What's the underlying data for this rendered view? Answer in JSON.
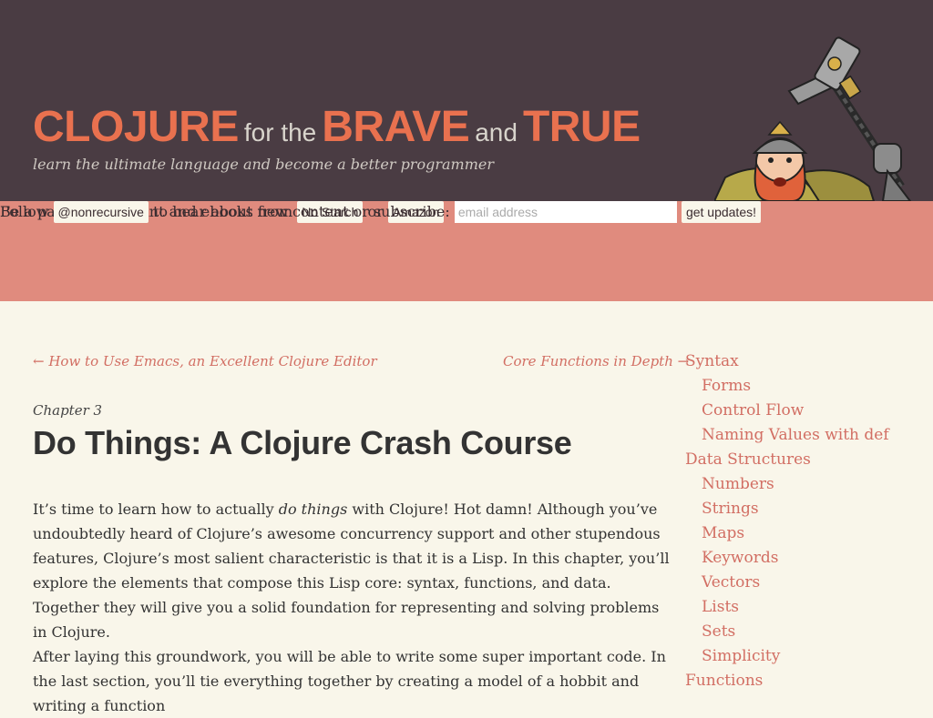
{
  "header": {
    "logo": {
      "w1": "CLOJURE",
      "w2": "for the",
      "w3": "BRAVE",
      "w4": "and",
      "w5": "TRUE"
    },
    "tagline": "learn the ultimate language and become a better programmer"
  },
  "promo": {
    "line1_text": "Be a pal and buy print and ebooks from",
    "no_starch": "No Starch",
    "or": "or",
    "amazon": "Amazon",
    "follow": "Follow",
    "twitter": "@nonrecursive",
    "subscribe_text": "to hear about new content or subscribe:",
    "email_placeholder": "email address",
    "submit": "get updates!"
  },
  "nav": {
    "prev": "← How to Use Emacs, an Excellent Clojure Editor",
    "next": "Core Functions in Depth →"
  },
  "article": {
    "chapter": "Chapter 3",
    "title": "Do Things: A Clojure Crash Course",
    "p1_a": "It’s time to learn how to actually ",
    "p1_em": "do things",
    "p1_b": " with Clojure! Hot damn! Although you’ve undoubtedly heard of Clojure’s awesome concurrency support and other stupendous features, Clojure’s most salient characteristic is that it is a Lisp. In this chapter, you’ll explore the elements that compose this Lisp core: syntax, functions, and data. Together they will give you a solid foundation for representing and solving problems in Clojure.",
    "p2": "After laying this groundwork, you will be able to write some super important code. In the last section, you’ll tie everything together by creating a model of a hobbit and writing a function"
  },
  "toc": [
    {
      "label": "Syntax",
      "level": 0
    },
    {
      "label": "Forms",
      "level": 1
    },
    {
      "label": "Control Flow",
      "level": 1
    },
    {
      "label": "Naming Values with def",
      "level": 1
    },
    {
      "label": "Data Structures",
      "level": 0
    },
    {
      "label": "Numbers",
      "level": 1
    },
    {
      "label": "Strings",
      "level": 1
    },
    {
      "label": "Maps",
      "level": 1
    },
    {
      "label": "Keywords",
      "level": 1
    },
    {
      "label": "Vectors",
      "level": 1
    },
    {
      "label": "Lists",
      "level": 1
    },
    {
      "label": "Sets",
      "level": 1
    },
    {
      "label": "Simplicity",
      "level": 1
    },
    {
      "label": "Functions",
      "level": 0
    }
  ],
  "colors": {
    "header_bg": "#4a3c43",
    "accent": "#e9714f",
    "promo_bg": "#e08b7e",
    "page_bg": "#f9f6ea",
    "link": "#d26e63"
  }
}
